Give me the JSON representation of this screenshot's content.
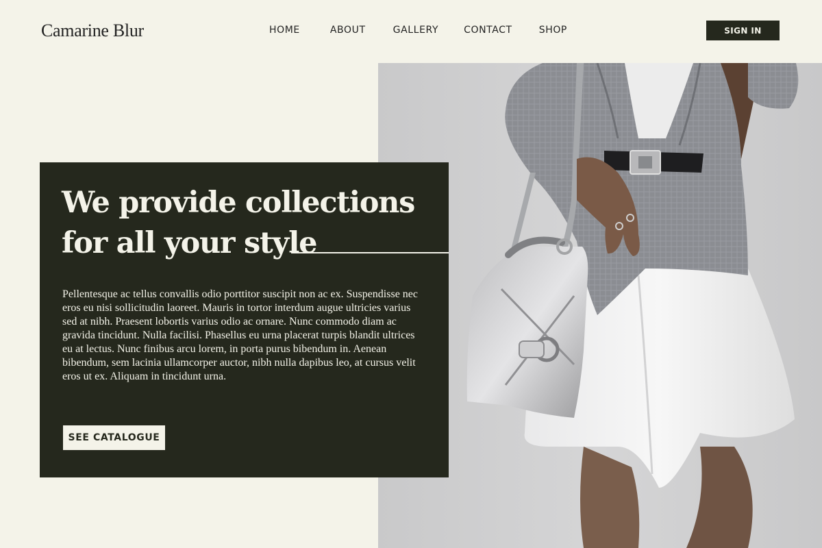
{
  "header": {
    "logo": "Camarine Blur",
    "nav": [
      "HOME",
      "ABOUT",
      "GALLERY",
      "CONTACT",
      "SHOP"
    ],
    "sign_in": "SIGN IN"
  },
  "hero": {
    "headline_line1": "We provide collections",
    "headline_line2": "for all your style",
    "body": "Pellentesque ac tellus convallis odio porttitor suscipit non ac ex. Suspendisse nec eros eu nisi sollicitudin laoreet. Mauris in tortor interdum augue ultricies varius sed at nibh. Praesent lobortis varius odio ac ornare. Nunc commodo diam ac gravida tincidunt. Nulla facilisi. Phasellus eu urna placerat turpis blandit ultrices eu at lectus. Nunc finibus arcu lorem, in porta purus bibendum in. Aenean bibendum, sem lacinia ullamcorper auctor, nibh nulla dapibus leo, at cursus velit eros ut ex. Aliquam in tincidunt urna.",
    "cta": "SEE CATALOGUE"
  },
  "colors": {
    "background": "#f4f3e9",
    "panel": "#25281d",
    "text_dark": "#222222",
    "text_light": "#f4f3e9"
  }
}
